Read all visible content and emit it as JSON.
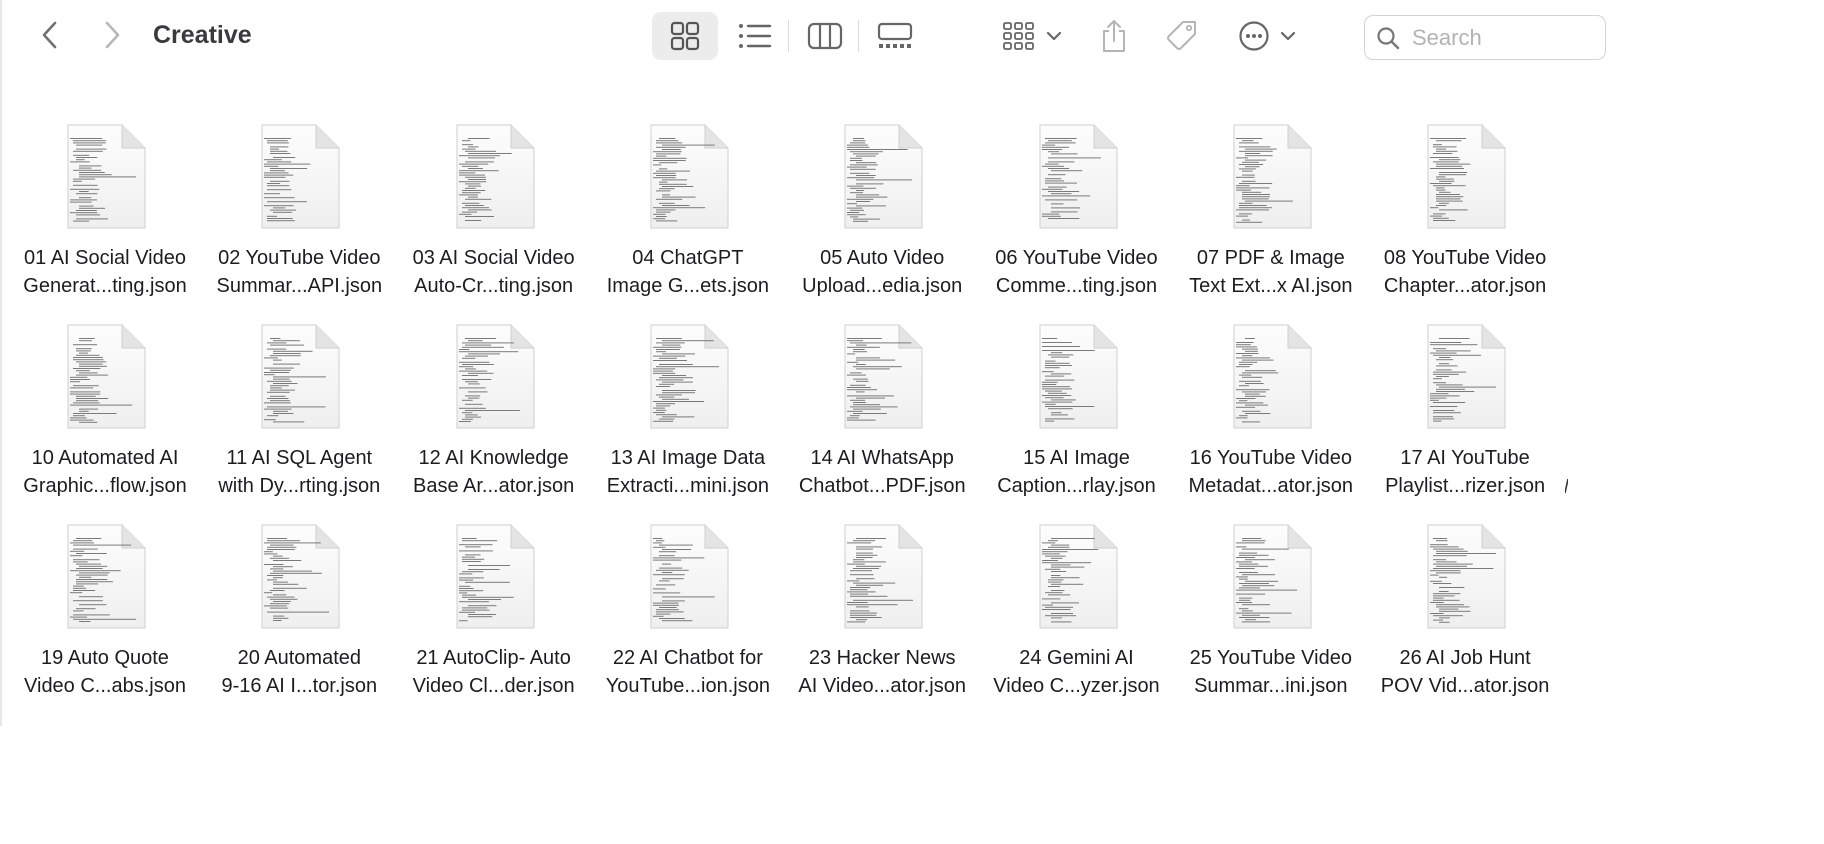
{
  "window": {
    "title": "Creative"
  },
  "toolbar": {
    "back": "chevron-left-icon",
    "forward": "chevron-right-icon",
    "views": [
      {
        "name": "icon-view",
        "icon": "grid-icon",
        "active": true
      },
      {
        "name": "list-view",
        "icon": "list-icon",
        "active": false
      },
      {
        "name": "column-view",
        "icon": "columns-icon",
        "active": false
      },
      {
        "name": "gallery-view",
        "icon": "gallery-icon",
        "active": false
      }
    ],
    "group": "group-icon",
    "share": "share-icon",
    "tags": "tag-icon",
    "more": "ellipsis-circle-icon"
  },
  "search": {
    "placeholder": "Search",
    "value": ""
  },
  "files": [
    {
      "line1": "01 AI Social Video",
      "line2": "Generat...ting.json"
    },
    {
      "line1": "02 YouTube Video",
      "line2": "Summar...API.json"
    },
    {
      "line1": "03 AI Social Video",
      "line2": "Auto-Cr...ting.json"
    },
    {
      "line1": "04 ChatGPT",
      "line2": "Image G...ets.json"
    },
    {
      "line1": "05 Auto Video",
      "line2": "Upload...edia.json"
    },
    {
      "line1": "06 YouTube Video",
      "line2": "Comme...ting.json"
    },
    {
      "line1": "07 PDF & Image",
      "line2": "Text Ext...x AI.json"
    },
    {
      "line1": "08 YouTube Video",
      "line2": "Chapter...ator.json"
    },
    {
      "line1": "10 Automated AI",
      "line2": "Graphic...flow.json"
    },
    {
      "line1": "11 AI SQL Agent",
      "line2": "with Dy...rting.json"
    },
    {
      "line1": "12 AI Knowledge",
      "line2": "Base Ar...ator.json"
    },
    {
      "line1": "13 AI Image Data",
      "line2": "Extracti...mini.json"
    },
    {
      "line1": "14 AI WhatsApp",
      "line2": "Chatbot...PDF.json"
    },
    {
      "line1": "15 AI Image",
      "line2": "Caption...rlay.json"
    },
    {
      "line1": "16 YouTube Video",
      "line2": "Metadat...ator.json"
    },
    {
      "line1": "17 AI YouTube",
      "line2": "Playlist...rizer.json"
    },
    {
      "line1": "19 Auto Quote",
      "line2": "Video C...abs.json"
    },
    {
      "line1": "20 Automated",
      "line2": "9-16 AI I...tor.json"
    },
    {
      "line1": "21 AutoClip- Auto",
      "line2": "Video Cl...der.json"
    },
    {
      "line1": "22 AI Chatbot for",
      "line2": "YouTube...ion.json"
    },
    {
      "line1": "23 Hacker News",
      "line2": "AI Video...ator.json"
    },
    {
      "line1": "24 Gemini AI",
      "line2": "Video C...yzer.json"
    },
    {
      "line1": "25 YouTube Video",
      "line2": "Summar...ini.json"
    },
    {
      "line1": "26 AI Job Hunt",
      "line2": "POV Vid...ator.json"
    }
  ]
}
